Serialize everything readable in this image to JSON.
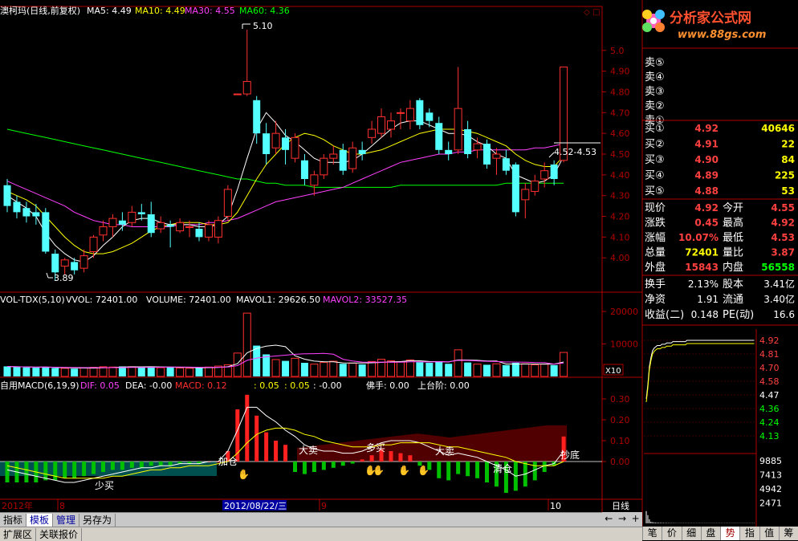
{
  "stock": {
    "title": "澳柯玛(日线,前复权)",
    "ma": [
      {
        "label": "MA5: 4.49",
        "color": "#ffffff"
      },
      {
        "label": "MA10: 4.49",
        "color": "#ffff00"
      },
      {
        "label": "MA30: 4.55",
        "color": "#ff40ff"
      },
      {
        "label": "MA60: 4.36",
        "color": "#00ff00"
      }
    ],
    "max_label": "5.10",
    "min_label": "3.89",
    "range_label": "4.52-4.53"
  },
  "logo": {
    "name": "分析家公式网",
    "url": "www.88gs.com"
  },
  "vol_header": {
    "items": [
      {
        "label": "VOL-TDX(5,10)",
        "color": "#ffffff"
      },
      {
        "label": "VVOL: 72401.00",
        "color": "#ffffff"
      },
      {
        "label": "VOLUME: 72401.00",
        "color": "#ffffff"
      },
      {
        "label": "MAVOL1: 29626.50",
        "color": "#ffffff"
      },
      {
        "label": "MAVOL2: 33527.35",
        "color": "#ff40ff"
      }
    ],
    "x10": "X10"
  },
  "macd_header": {
    "items": [
      {
        "label": "自用MACD(6,19,9)",
        "color": "#ffffff"
      },
      {
        "label": "DIF: 0.05",
        "color": "#ff40ff"
      },
      {
        "label": "DEA: -0.00",
        "color": "#ffffff"
      },
      {
        "label": "MACD: 0.12",
        "color": "#ff3030"
      },
      {
        "label": ": 0.05",
        "color": "#ffff00"
      },
      {
        "label": ": 0.05",
        "color": "#ffff00"
      },
      {
        "label": ": -0.00",
        "color": "#ffffff"
      },
      {
        "label": "佛手: 0.00",
        "color": "#ffffff"
      },
      {
        "label": "上台阶: 0.00",
        "color": "#ffffff"
      }
    ]
  },
  "signals": [
    "少买",
    "加仓",
    "大卖",
    "多买",
    "大卖",
    "清仓",
    "抄底"
  ],
  "date_axis": {
    "labels": [
      "2012年",
      "8",
      "2012/08/22/三",
      "9",
      "10"
    ],
    "period": "日线"
  },
  "price_axis": [
    "5.0",
    "4.90",
    "4.80",
    "4.70",
    "4.60",
    "4.50",
    "4.40",
    "4.30",
    "4.20",
    "4.10",
    "4.00"
  ],
  "vol_axis": [
    "20000",
    "10000"
  ],
  "macd_axis": [
    "0.30",
    "0.20",
    "0.10",
    "0.00"
  ],
  "order_book": {
    "sell": [
      {
        "label": "卖⑤"
      },
      {
        "label": "卖④"
      },
      {
        "label": "卖③"
      },
      {
        "label": "卖②"
      },
      {
        "label": "卖①"
      }
    ],
    "buy": [
      {
        "label": "买①",
        "price": "4.92",
        "vol": "40646"
      },
      {
        "label": "买②",
        "price": "4.91",
        "vol": "22"
      },
      {
        "label": "买③",
        "price": "4.90",
        "vol": "84"
      },
      {
        "label": "买④",
        "price": "4.89",
        "vol": "225"
      },
      {
        "label": "买⑤",
        "price": "4.88",
        "vol": "53"
      }
    ]
  },
  "quote": [
    {
      "l1": "现价",
      "v1": "4.92",
      "c1": "#ff4040",
      "l2": "今开",
      "v2": "4.55",
      "c2": "#ff4040"
    },
    {
      "l1": "涨跌",
      "v1": "0.45",
      "c1": "#ff4040",
      "l2": "最高",
      "v2": "4.92",
      "c2": "#ff4040"
    },
    {
      "l1": "涨幅",
      "v1": "10.07%",
      "c1": "#ff4040",
      "l2": "最低",
      "v2": "4.53",
      "c2": "#ff4040"
    },
    {
      "l1": "总量",
      "v1": "72401",
      "c1": "#ffff00",
      "l2": "量比",
      "v2": "3.87",
      "c2": "#ff4040"
    },
    {
      "l1": "外盘",
      "v1": "15843",
      "c1": "#ff4040",
      "l2": "内盘",
      "v2": "56558",
      "c2": "#00ff00"
    }
  ],
  "fundamentals": [
    {
      "l1": "换手",
      "v1": "2.13%",
      "l2": "股本",
      "v2": "3.41亿"
    },
    {
      "l1": "净资",
      "v1": "1.91",
      "l2": "流通",
      "v2": "3.40亿"
    },
    {
      "l1": "收益(二)",
      "v1": "0.148",
      "l2": "PE(动)",
      "v2": "16.6"
    }
  ],
  "mini_price_axis": [
    {
      "v": "4.92",
      "c": "#ff4040"
    },
    {
      "v": "4.81",
      "c": "#ff4040"
    },
    {
      "v": "4.70",
      "c": "#ff4040"
    },
    {
      "v": "4.58",
      "c": "#ff4040"
    },
    {
      "v": "4.47",
      "c": "#ffffff"
    },
    {
      "v": "4.36",
      "c": "#00ff00"
    },
    {
      "v": "4.24",
      "c": "#00ff00"
    },
    {
      "v": "4.13",
      "c": "#00ff00"
    }
  ],
  "mini_vol_axis": [
    "9885",
    "7413",
    "4942",
    "2471"
  ],
  "bottom_tabs": [
    "指标",
    "模板",
    "管理",
    "另存为"
  ],
  "status_tabs": [
    "扩展区",
    "关联报价"
  ],
  "right_tabs": [
    "笔",
    "价",
    "细",
    "盘",
    "势",
    "指",
    "值",
    "筹"
  ],
  "chart_data": {
    "type": "candlestick",
    "ylim": [
      3.85,
      5.15
    ],
    "candles": [
      {
        "o": 4.35,
        "c": 4.25,
        "h": 4.38,
        "l": 4.22
      },
      {
        "o": 4.27,
        "c": 4.22,
        "h": 4.3,
        "l": 4.19
      },
      {
        "o": 4.24,
        "c": 4.2,
        "h": 4.27,
        "l": 4.17
      },
      {
        "o": 4.22,
        "c": 4.2,
        "h": 4.26,
        "l": 4.16
      },
      {
        "o": 4.22,
        "c": 4.03,
        "h": 4.24,
        "l": 4.02
      },
      {
        "o": 4.02,
        "c": 3.93,
        "h": 4.04,
        "l": 3.89
      },
      {
        "o": 3.96,
        "c": 3.99,
        "h": 4.0,
        "l": 3.92
      },
      {
        "o": 3.98,
        "c": 3.94,
        "h": 4.0,
        "l": 3.92
      },
      {
        "o": 3.95,
        "c": 4.01,
        "h": 4.04,
        "l": 3.93
      },
      {
        "o": 4.03,
        "c": 4.1,
        "h": 4.11,
        "l": 4.0
      },
      {
        "o": 4.11,
        "c": 4.15,
        "h": 4.18,
        "l": 4.08
      },
      {
        "o": 4.15,
        "c": 4.19,
        "h": 4.21,
        "l": 4.1
      },
      {
        "o": 4.18,
        "c": 4.16,
        "h": 4.22,
        "l": 4.13
      },
      {
        "o": 4.17,
        "c": 4.22,
        "h": 4.25,
        "l": 4.15
      },
      {
        "o": 4.22,
        "c": 4.21,
        "h": 4.26,
        "l": 4.18
      },
      {
        "o": 4.21,
        "c": 4.12,
        "h": 4.27,
        "l": 4.1
      },
      {
        "o": 4.14,
        "c": 4.17,
        "h": 4.2,
        "l": 4.12
      },
      {
        "o": 4.16,
        "c": 4.15,
        "h": 4.18,
        "l": 4.05
      },
      {
        "o": 4.13,
        "c": 4.17,
        "h": 4.19,
        "l": 4.12
      },
      {
        "o": 4.15,
        "c": 4.15,
        "h": 4.18,
        "l": 4.1
      },
      {
        "o": 4.14,
        "c": 4.1,
        "h": 4.17,
        "l": 4.08
      },
      {
        "o": 4.1,
        "c": 4.16,
        "h": 4.18,
        "l": 4.08
      },
      {
        "o": 4.1,
        "c": 4.18,
        "h": 4.2,
        "l": 4.07
      },
      {
        "o": 4.2,
        "c": 4.33,
        "h": 4.35,
        "l": 4.18
      },
      {
        "o": 4.79,
        "c": 4.79,
        "h": 4.79,
        "l": 4.79
      },
      {
        "o": 4.79,
        "c": 4.85,
        "h": 5.1,
        "l": 4.78
      },
      {
        "o": 4.76,
        "c": 4.6,
        "h": 4.78,
        "l": 4.55
      },
      {
        "o": 4.6,
        "c": 4.5,
        "h": 4.65,
        "l": 4.45
      },
      {
        "o": 4.53,
        "c": 4.6,
        "h": 4.66,
        "l": 4.5
      },
      {
        "o": 4.58,
        "c": 4.52,
        "h": 4.62,
        "l": 4.45
      },
      {
        "o": 4.48,
        "c": 4.58,
        "h": 4.6,
        "l": 4.46
      },
      {
        "o": 4.47,
        "c": 4.38,
        "h": 4.5,
        "l": 4.35
      },
      {
        "o": 4.35,
        "c": 4.4,
        "h": 4.42,
        "l": 4.3
      },
      {
        "o": 4.4,
        "c": 4.48,
        "h": 4.5,
        "l": 4.38
      },
      {
        "o": 4.48,
        "c": 4.5,
        "h": 4.54,
        "l": 4.45
      },
      {
        "o": 4.52,
        "c": 4.42,
        "h": 4.55,
        "l": 4.4
      },
      {
        "o": 4.43,
        "c": 4.53,
        "h": 4.56,
        "l": 4.41
      },
      {
        "o": 4.52,
        "c": 4.5,
        "h": 4.56,
        "l": 4.47
      },
      {
        "o": 4.58,
        "c": 4.62,
        "h": 4.66,
        "l": 4.55
      },
      {
        "o": 4.6,
        "c": 4.68,
        "h": 4.72,
        "l": 4.58
      },
      {
        "o": 4.62,
        "c": 4.66,
        "h": 4.7,
        "l": 4.58
      },
      {
        "o": 4.7,
        "c": 4.7,
        "h": 4.72,
        "l": 4.62
      },
      {
        "o": 4.66,
        "c": 4.72,
        "h": 4.76,
        "l": 4.62
      },
      {
        "o": 4.76,
        "c": 4.64,
        "h": 4.77,
        "l": 4.62
      },
      {
        "o": 4.7,
        "c": 4.66,
        "h": 4.72,
        "l": 4.63
      },
      {
        "o": 4.65,
        "c": 4.52,
        "h": 4.68,
        "l": 4.5
      },
      {
        "o": 4.52,
        "c": 4.5,
        "h": 4.56,
        "l": 4.47
      },
      {
        "o": 4.52,
        "c": 4.72,
        "h": 4.92,
        "l": 4.5
      },
      {
        "o": 4.62,
        "c": 4.5,
        "h": 4.66,
        "l": 4.48
      },
      {
        "o": 4.52,
        "c": 4.55,
        "h": 4.58,
        "l": 4.48
      },
      {
        "o": 4.55,
        "c": 4.45,
        "h": 4.57,
        "l": 4.43
      },
      {
        "o": 4.48,
        "c": 4.5,
        "h": 4.53,
        "l": 4.4
      },
      {
        "o": 4.48,
        "c": 4.42,
        "h": 4.52,
        "l": 4.4
      },
      {
        "o": 4.45,
        "c": 4.22,
        "h": 4.46,
        "l": 4.2
      },
      {
        "o": 4.28,
        "c": 4.33,
        "h": 4.36,
        "l": 4.19
      },
      {
        "o": 4.32,
        "c": 4.37,
        "h": 4.4,
        "l": 4.3
      },
      {
        "o": 4.38,
        "c": 4.42,
        "h": 4.46,
        "l": 4.34
      },
      {
        "o": 4.45,
        "c": 4.38,
        "h": 4.47,
        "l": 4.35
      },
      {
        "o": 4.47,
        "c": 4.92,
        "h": 4.92,
        "l": 4.46
      }
    ],
    "volume": [
      3100,
      2900,
      2800,
      2700,
      2900,
      2600,
      2500,
      2400,
      2600,
      2800,
      3000,
      2900,
      3100,
      3000,
      2800,
      3100,
      2700,
      2900,
      2600,
      2500,
      2700,
      2900,
      3200,
      3600,
      7200,
      19500,
      9500,
      6800,
      5200,
      4800,
      5600,
      4200,
      3800,
      4300,
      4700,
      3900,
      4100,
      3700,
      4600,
      5300,
      4800,
      4500,
      5100,
      4400,
      4200,
      4700,
      3900,
      8200,
      4300,
      3800,
      3600,
      3900,
      3500,
      4200,
      3900,
      3600,
      3800,
      3500,
      7400
    ],
    "ma5": [
      4.3,
      4.27,
      4.24,
      4.2,
      4.12,
      4.06,
      4.02,
      3.99,
      3.98,
      4.01,
      4.06,
      4.1,
      4.15,
      4.18,
      4.19,
      4.19,
      4.17,
      4.16,
      4.16,
      4.16,
      4.15,
      4.15,
      4.16,
      4.2,
      4.33,
      4.48,
      4.62,
      4.7,
      4.65,
      4.59,
      4.56,
      4.52,
      4.48,
      4.46,
      4.46,
      4.46,
      4.47,
      4.5,
      4.54,
      4.58,
      4.62,
      4.65,
      4.66,
      4.66,
      4.64,
      4.62,
      4.6,
      4.6,
      4.59,
      4.56,
      4.54,
      4.5,
      4.48,
      4.4,
      4.38,
      4.36,
      4.37,
      4.4,
      4.49
    ],
    "ma10": [
      4.32,
      4.3,
      4.28,
      4.25,
      4.2,
      4.15,
      4.1,
      4.06,
      4.03,
      4.02,
      4.02,
      4.03,
      4.05,
      4.07,
      4.1,
      4.13,
      4.15,
      4.16,
      4.17,
      4.17,
      4.17,
      4.16,
      4.16,
      4.17,
      4.22,
      4.3,
      4.38,
      4.45,
      4.5,
      4.55,
      4.58,
      4.6,
      4.59,
      4.57,
      4.54,
      4.52,
      4.5,
      4.5,
      4.51,
      4.52,
      4.54,
      4.56,
      4.58,
      4.6,
      4.61,
      4.62,
      4.62,
      4.62,
      4.61,
      4.6,
      4.58,
      4.56,
      4.54,
      4.5,
      4.47,
      4.45,
      4.44,
      4.44,
      4.49
    ],
    "ma30": [
      4.37,
      4.35,
      4.33,
      4.31,
      4.29,
      4.27,
      4.25,
      4.22,
      4.2,
      4.18,
      4.17,
      4.16,
      4.16,
      4.15,
      4.15,
      4.15,
      4.15,
      4.15,
      4.16,
      4.16,
      4.16,
      4.17,
      4.17,
      4.18,
      4.19,
      4.21,
      4.23,
      4.25,
      4.27,
      4.28,
      4.29,
      4.3,
      4.31,
      4.32,
      4.33,
      4.34,
      4.36,
      4.38,
      4.4,
      4.42,
      4.44,
      4.46,
      4.47,
      4.48,
      4.49,
      4.5,
      4.5,
      4.51,
      4.51,
      4.52,
      4.52,
      4.52,
      4.52,
      4.52,
      4.52,
      4.53,
      4.53,
      4.54,
      4.55
    ],
    "ma60": [
      4.62,
      4.61,
      4.6,
      4.59,
      4.58,
      4.57,
      4.56,
      4.55,
      4.54,
      4.53,
      4.52,
      4.51,
      4.5,
      4.49,
      4.48,
      4.47,
      4.46,
      4.45,
      4.44,
      4.43,
      4.42,
      4.41,
      4.4,
      4.39,
      4.38,
      4.38,
      4.37,
      4.36,
      4.36,
      4.35,
      4.35,
      4.35,
      4.34,
      4.34,
      4.34,
      4.34,
      4.34,
      4.34,
      4.34,
      4.34,
      4.34,
      4.35,
      4.35,
      4.35,
      4.35,
      4.35,
      4.35,
      4.35,
      4.35,
      4.35,
      4.35,
      4.35,
      4.36,
      4.36,
      4.36,
      4.36,
      4.36,
      4.36,
      4.36
    ],
    "macd": [
      -0.1,
      -0.1,
      -0.1,
      -0.1,
      -0.09,
      -0.09,
      -0.08,
      -0.08,
      -0.07,
      -0.06,
      -0.05,
      -0.04,
      -0.04,
      -0.03,
      -0.03,
      -0.02,
      -0.02,
      -0.02,
      -0.01,
      -0.01,
      -0.01,
      0.0,
      0.0,
      0.05,
      0.25,
      0.32,
      0.22,
      0.14,
      0.1,
      0.08,
      -0.05,
      -0.06,
      -0.05,
      -0.04,
      -0.03,
      -0.02,
      -0.01,
      0.01,
      0.03,
      0.06,
      0.05,
      0.04,
      0.03,
      -0.02,
      -0.04,
      -0.08,
      -0.09,
      -0.06,
      -0.07,
      -0.08,
      -0.1,
      -0.12,
      -0.15,
      -0.14,
      -0.12,
      -0.09,
      -0.05,
      -0.02,
      0.12
    ],
    "dif": [
      -0.04,
      -0.05,
      -0.06,
      -0.07,
      -0.08,
      -0.09,
      -0.1,
      -0.1,
      -0.09,
      -0.08,
      -0.07,
      -0.06,
      -0.05,
      -0.04,
      -0.03,
      -0.03,
      -0.02,
      -0.02,
      -0.01,
      -0.01,
      -0.01,
      0.0,
      0.0,
      0.05,
      0.15,
      0.26,
      0.26,
      0.22,
      0.19,
      0.15,
      0.12,
      0.08,
      0.06,
      0.05,
      0.05,
      0.04,
      0.04,
      0.05,
      0.07,
      0.09,
      0.1,
      0.1,
      0.1,
      0.09,
      0.07,
      0.05,
      0.03,
      0.04,
      0.03,
      0.02,
      0.0,
      -0.02,
      -0.04,
      -0.07,
      -0.06,
      -0.04,
      -0.02,
      -0.01,
      0.05
    ],
    "dea": [
      -0.02,
      -0.03,
      -0.04,
      -0.05,
      -0.06,
      -0.07,
      -0.08,
      -0.08,
      -0.08,
      -0.08,
      -0.08,
      -0.07,
      -0.07,
      -0.06,
      -0.05,
      -0.04,
      -0.04,
      -0.03,
      -0.03,
      -0.02,
      -0.02,
      -0.02,
      -0.01,
      0.0,
      0.04,
      0.09,
      0.13,
      0.15,
      0.16,
      0.16,
      0.15,
      0.13,
      0.12,
      0.1,
      0.09,
      0.08,
      0.07,
      0.07,
      0.07,
      0.08,
      0.08,
      0.09,
      0.09,
      0.09,
      0.09,
      0.08,
      0.07,
      0.07,
      0.06,
      0.05,
      0.04,
      0.03,
      0.02,
      0.0,
      -0.01,
      -0.02,
      -0.02,
      -0.02,
      0.0
    ],
    "mini": [
      4.47,
      4.58,
      4.72,
      4.79,
      4.84,
      4.86,
      4.87,
      4.88,
      4.88,
      4.88,
      4.89,
      4.89,
      4.89,
      4.9,
      4.9,
      4.9,
      4.9,
      4.91,
      4.91,
      4.91,
      4.91,
      4.91,
      4.91,
      4.91,
      4.91,
      4.91,
      4.92,
      4.92,
      4.92,
      4.92,
      4.92,
      4.92,
      4.92,
      4.92,
      4.92,
      4.92,
      4.92,
      4.92,
      4.92,
      4.92,
      4.92,
      4.92,
      4.92,
      4.92,
      4.92,
      4.92,
      4.92,
      4.92,
      4.92,
      4.92,
      4.92,
      4.92,
      4.92,
      4.92,
      4.92,
      4.92,
      4.92,
      4.92,
      4.92,
      4.92,
      4.92,
      4.92,
      4.92,
      4.92,
      4.92,
      4.92,
      4.92,
      4.92,
      4.92,
      4.92
    ]
  }
}
